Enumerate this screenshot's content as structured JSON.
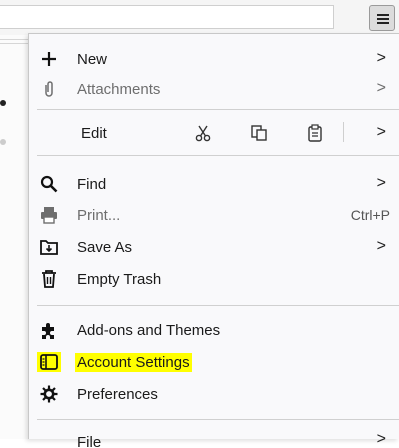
{
  "menu": {
    "items": [
      {
        "label": "New",
        "icon": "plus-icon",
        "submenu": true
      },
      {
        "label": "Attachments",
        "icon": "paperclip-icon",
        "submenu": true,
        "disabled": true
      },
      {
        "label": "Edit",
        "tools": [
          "cut-icon",
          "copy-icon",
          "paste-icon"
        ],
        "submenu": true
      },
      {
        "label": "Find",
        "icon": "magnifier-icon",
        "submenu": true
      },
      {
        "label": "Print...",
        "icon": "printer-icon",
        "shortcut": "Ctrl+P",
        "disabled": true
      },
      {
        "label": "Save As",
        "icon": "save-as-icon",
        "submenu": true
      },
      {
        "label": "Empty Trash",
        "icon": "trash-icon"
      },
      {
        "label": "Add-ons and Themes",
        "icon": "puzzle-icon"
      },
      {
        "label": "Account Settings",
        "icon": "account-settings-icon",
        "highlighted": true,
        "highlight_color": "#ffff00"
      },
      {
        "label": "Preferences",
        "icon": "gear-icon"
      },
      {
        "label": "File",
        "partially_visible": true,
        "submenu": true
      }
    ],
    "arrow_glyph": ">"
  }
}
